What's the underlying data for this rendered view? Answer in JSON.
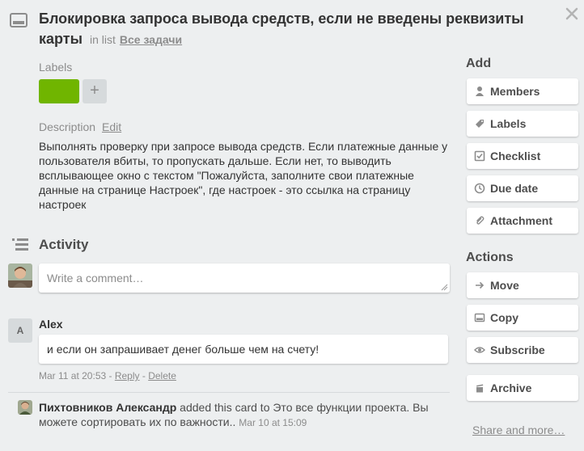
{
  "card": {
    "title": "Блокировка запроса вывода средств, если не введены реквизиты карты",
    "in_list_prefix": "in list",
    "list_name": "Все задачи"
  },
  "labels": {
    "heading": "Labels",
    "items": [
      {
        "color": "#70b500"
      }
    ],
    "add_symbol": "+"
  },
  "description": {
    "heading": "Description",
    "edit_label": "Edit",
    "text": "Выполнять проверку при запросе вывода средств. Если платежные данные у пользователя вбиты, то пропускать дальше. Если нет, то выводить всплывающее окно с текстом \"Пожалуйста, заполните свои платежные данные на странице Настроек\", где настроек - это ссылка на страницу настроек"
  },
  "activity": {
    "heading": "Activity",
    "comment_placeholder": "Write a comment…",
    "comments": [
      {
        "avatar_initial": "A",
        "author": "Alex",
        "text": "и если он запрашивает денег больше чем на счету!",
        "date": "Mar 11 at 20:53",
        "separator": " - ",
        "reply_label": "Reply",
        "delete_label": "Delete"
      }
    ],
    "events": [
      {
        "author": "Пихтовников Александр",
        "text": " added this card to Это все функции проекта. Вы можете сортировать их по важности..",
        "date": "Mar 10 at 15:09"
      }
    ]
  },
  "sidebar": {
    "add_heading": "Add",
    "add_buttons": [
      {
        "label": "Members",
        "icon": "person-icon"
      },
      {
        "label": "Labels",
        "icon": "tag-icon"
      },
      {
        "label": "Checklist",
        "icon": "checkbox-icon"
      },
      {
        "label": "Due date",
        "icon": "clock-icon"
      },
      {
        "label": "Attachment",
        "icon": "paperclip-icon"
      }
    ],
    "actions_heading": "Actions",
    "action_buttons": [
      {
        "label": "Move",
        "icon": "arrow-right-icon"
      },
      {
        "label": "Copy",
        "icon": "card-icon"
      },
      {
        "label": "Subscribe",
        "icon": "eye-icon"
      },
      {
        "label": "Archive",
        "icon": "archive-icon"
      }
    ],
    "share_label": "Share and more…"
  }
}
